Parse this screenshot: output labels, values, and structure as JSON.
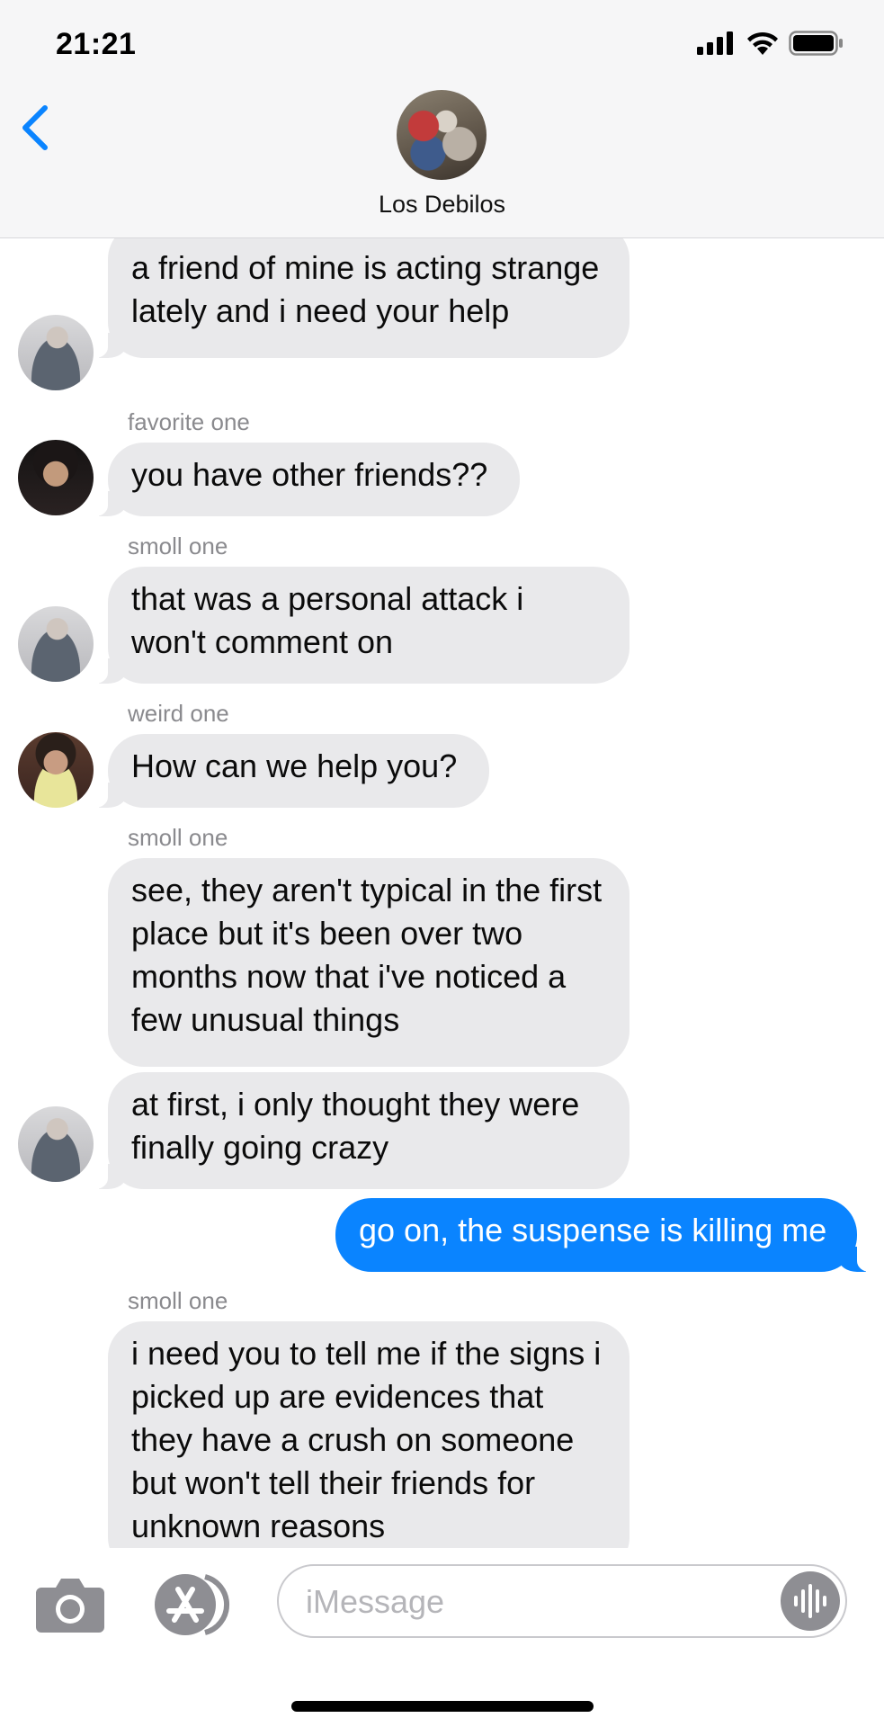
{
  "status_bar": {
    "time": "21:21"
  },
  "header": {
    "title": "Los Debilos",
    "back_icon": "chevron-left-icon"
  },
  "messages": [
    {
      "text": "a friend of mine is acting strange lately and i need your help"
    },
    {
      "sender": "favorite one",
      "text": "you have other friends??"
    },
    {
      "sender": "smoll one",
      "text": "that was a personal attack i won't comment on"
    },
    {
      "sender": "weird one",
      "text": "How can we help you?"
    },
    {
      "sender": "smoll one",
      "text": "see, they aren't typical in the first place but it's been over two months now that i've noticed a few unusual things"
    },
    {
      "text": "at first, i only thought they were finally going crazy"
    },
    {
      "text": "go on, the suspense is killing me",
      "outgoing": true
    },
    {
      "sender": "smoll one",
      "text": "i need you to tell me if the signs i picked up are evidences that they have a crush on someone but won't tell their friends for unknown reasons"
    }
  ],
  "input": {
    "placeholder": "iMessage"
  },
  "colors": {
    "outgoing_bubble": "#0a84ff",
    "incoming_bubble": "#e9e9eb",
    "sender_label": "#8a8a8e"
  }
}
